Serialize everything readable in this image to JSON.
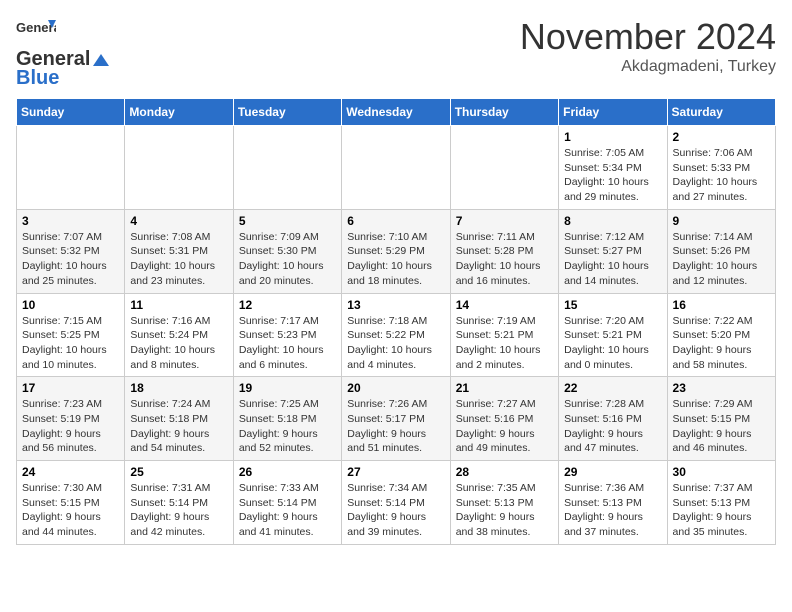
{
  "header": {
    "logo_general": "General",
    "logo_blue": "Blue",
    "month_title": "November 2024",
    "location": "Akdagmadeni, Turkey"
  },
  "weekdays": [
    "Sunday",
    "Monday",
    "Tuesday",
    "Wednesday",
    "Thursday",
    "Friday",
    "Saturday"
  ],
  "weeks": [
    [
      {
        "day": "",
        "info": ""
      },
      {
        "day": "",
        "info": ""
      },
      {
        "day": "",
        "info": ""
      },
      {
        "day": "",
        "info": ""
      },
      {
        "day": "",
        "info": ""
      },
      {
        "day": "1",
        "info": "Sunrise: 7:05 AM\nSunset: 5:34 PM\nDaylight: 10 hours and 29 minutes."
      },
      {
        "day": "2",
        "info": "Sunrise: 7:06 AM\nSunset: 5:33 PM\nDaylight: 10 hours and 27 minutes."
      }
    ],
    [
      {
        "day": "3",
        "info": "Sunrise: 7:07 AM\nSunset: 5:32 PM\nDaylight: 10 hours and 25 minutes."
      },
      {
        "day": "4",
        "info": "Sunrise: 7:08 AM\nSunset: 5:31 PM\nDaylight: 10 hours and 23 minutes."
      },
      {
        "day": "5",
        "info": "Sunrise: 7:09 AM\nSunset: 5:30 PM\nDaylight: 10 hours and 20 minutes."
      },
      {
        "day": "6",
        "info": "Sunrise: 7:10 AM\nSunset: 5:29 PM\nDaylight: 10 hours and 18 minutes."
      },
      {
        "day": "7",
        "info": "Sunrise: 7:11 AM\nSunset: 5:28 PM\nDaylight: 10 hours and 16 minutes."
      },
      {
        "day": "8",
        "info": "Sunrise: 7:12 AM\nSunset: 5:27 PM\nDaylight: 10 hours and 14 minutes."
      },
      {
        "day": "9",
        "info": "Sunrise: 7:14 AM\nSunset: 5:26 PM\nDaylight: 10 hours and 12 minutes."
      }
    ],
    [
      {
        "day": "10",
        "info": "Sunrise: 7:15 AM\nSunset: 5:25 PM\nDaylight: 10 hours and 10 minutes."
      },
      {
        "day": "11",
        "info": "Sunrise: 7:16 AM\nSunset: 5:24 PM\nDaylight: 10 hours and 8 minutes."
      },
      {
        "day": "12",
        "info": "Sunrise: 7:17 AM\nSunset: 5:23 PM\nDaylight: 10 hours and 6 minutes."
      },
      {
        "day": "13",
        "info": "Sunrise: 7:18 AM\nSunset: 5:22 PM\nDaylight: 10 hours and 4 minutes."
      },
      {
        "day": "14",
        "info": "Sunrise: 7:19 AM\nSunset: 5:21 PM\nDaylight: 10 hours and 2 minutes."
      },
      {
        "day": "15",
        "info": "Sunrise: 7:20 AM\nSunset: 5:21 PM\nDaylight: 10 hours and 0 minutes."
      },
      {
        "day": "16",
        "info": "Sunrise: 7:22 AM\nSunset: 5:20 PM\nDaylight: 9 hours and 58 minutes."
      }
    ],
    [
      {
        "day": "17",
        "info": "Sunrise: 7:23 AM\nSunset: 5:19 PM\nDaylight: 9 hours and 56 minutes."
      },
      {
        "day": "18",
        "info": "Sunrise: 7:24 AM\nSunset: 5:18 PM\nDaylight: 9 hours and 54 minutes."
      },
      {
        "day": "19",
        "info": "Sunrise: 7:25 AM\nSunset: 5:18 PM\nDaylight: 9 hours and 52 minutes."
      },
      {
        "day": "20",
        "info": "Sunrise: 7:26 AM\nSunset: 5:17 PM\nDaylight: 9 hours and 51 minutes."
      },
      {
        "day": "21",
        "info": "Sunrise: 7:27 AM\nSunset: 5:16 PM\nDaylight: 9 hours and 49 minutes."
      },
      {
        "day": "22",
        "info": "Sunrise: 7:28 AM\nSunset: 5:16 PM\nDaylight: 9 hours and 47 minutes."
      },
      {
        "day": "23",
        "info": "Sunrise: 7:29 AM\nSunset: 5:15 PM\nDaylight: 9 hours and 46 minutes."
      }
    ],
    [
      {
        "day": "24",
        "info": "Sunrise: 7:30 AM\nSunset: 5:15 PM\nDaylight: 9 hours and 44 minutes."
      },
      {
        "day": "25",
        "info": "Sunrise: 7:31 AM\nSunset: 5:14 PM\nDaylight: 9 hours and 42 minutes."
      },
      {
        "day": "26",
        "info": "Sunrise: 7:33 AM\nSunset: 5:14 PM\nDaylight: 9 hours and 41 minutes."
      },
      {
        "day": "27",
        "info": "Sunrise: 7:34 AM\nSunset: 5:14 PM\nDaylight: 9 hours and 39 minutes."
      },
      {
        "day": "28",
        "info": "Sunrise: 7:35 AM\nSunset: 5:13 PM\nDaylight: 9 hours and 38 minutes."
      },
      {
        "day": "29",
        "info": "Sunrise: 7:36 AM\nSunset: 5:13 PM\nDaylight: 9 hours and 37 minutes."
      },
      {
        "day": "30",
        "info": "Sunrise: 7:37 AM\nSunset: 5:13 PM\nDaylight: 9 hours and 35 minutes."
      }
    ]
  ]
}
